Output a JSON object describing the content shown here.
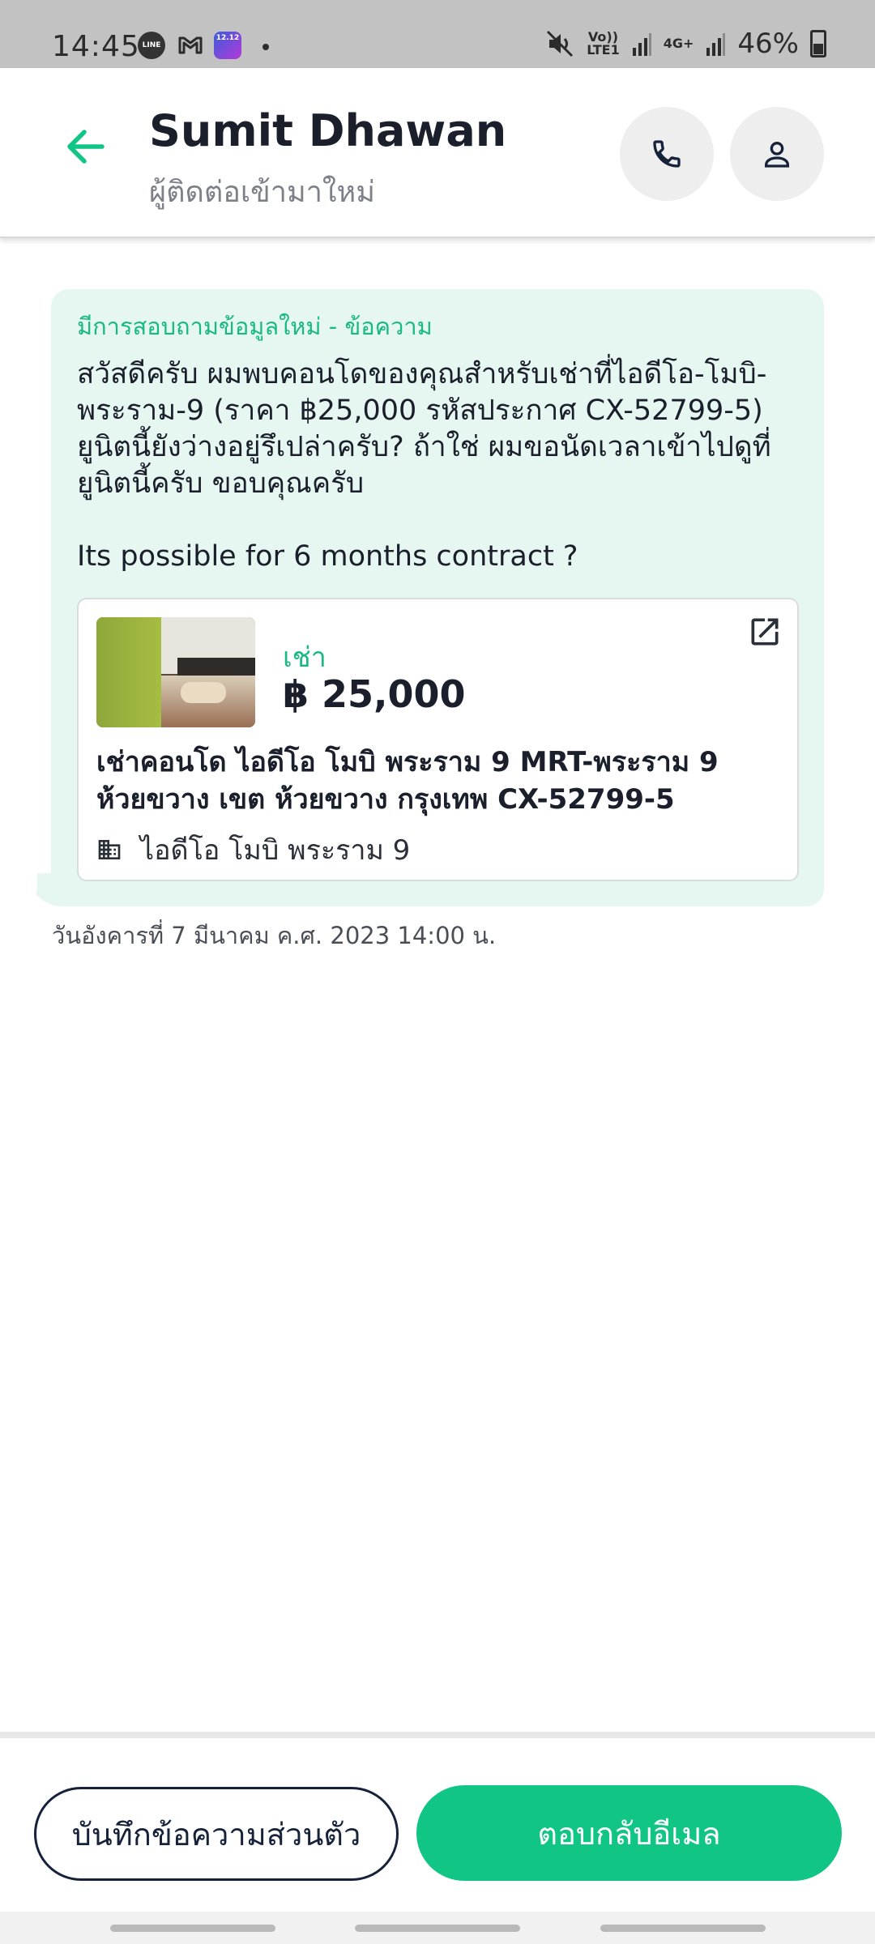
{
  "status_bar": {
    "time": "14:45",
    "notification_icons": [
      "line-icon",
      "gmail-icon",
      "lazada-icon"
    ],
    "laz_badge": "12.12",
    "network1": "Vo))",
    "network2": "LTE1",
    "network3": "4G+",
    "battery": "46%"
  },
  "header": {
    "name": "Sumit Dhawan",
    "subtitle": "ผู้ติดต่อเข้ามาใหม่",
    "back_icon": "arrow-left-icon",
    "call_icon": "phone-icon",
    "profile_icon": "person-icon"
  },
  "message": {
    "title": "มีการสอบถามข้อมูลใหม่ - ข้อความ",
    "body": "สวัสดีครับ ผมพบคอนโดของคุณสำหรับเช่าที่ไอดีโอ-โมบิ-พระราม-9 (ราคา ฿25,000 รหัสประกาศ CX-52799-5) ยูนิตนี้ยังว่างอยู่รึเปล่าครับ? ถ้าใช่ ผมขอนัดเวลาเข้าไปดูที่ยูนิตนี้ครับ ขอบคุณครับ\n\nIts possible for 6 months contract ?",
    "timestamp": "วันอังคารที่ 7 มีนาคม ค.ศ. 2023 14:00 น."
  },
  "listing": {
    "type": "เช่า",
    "price": "฿ 25,000",
    "title": "เช่าคอนโด  ไอดีโอ โมบิ พระราม 9 MRT-พระราม 9 ห้วยขวาง เขต ห้วยขวาง กรุงเทพ CX-52799-5",
    "project": "ไอดีโอ โมบิ พระราม 9",
    "project_icon": "building-icon",
    "open_icon": "open-external-icon"
  },
  "footer": {
    "note_button": "บันทึกข้อความส่วนตัว",
    "reply_button": "ตอบกลับอีเมล"
  },
  "colors": {
    "accent": "#11c585",
    "bubble": "#e6f7f1",
    "status_bar": "#c2c2c2"
  }
}
